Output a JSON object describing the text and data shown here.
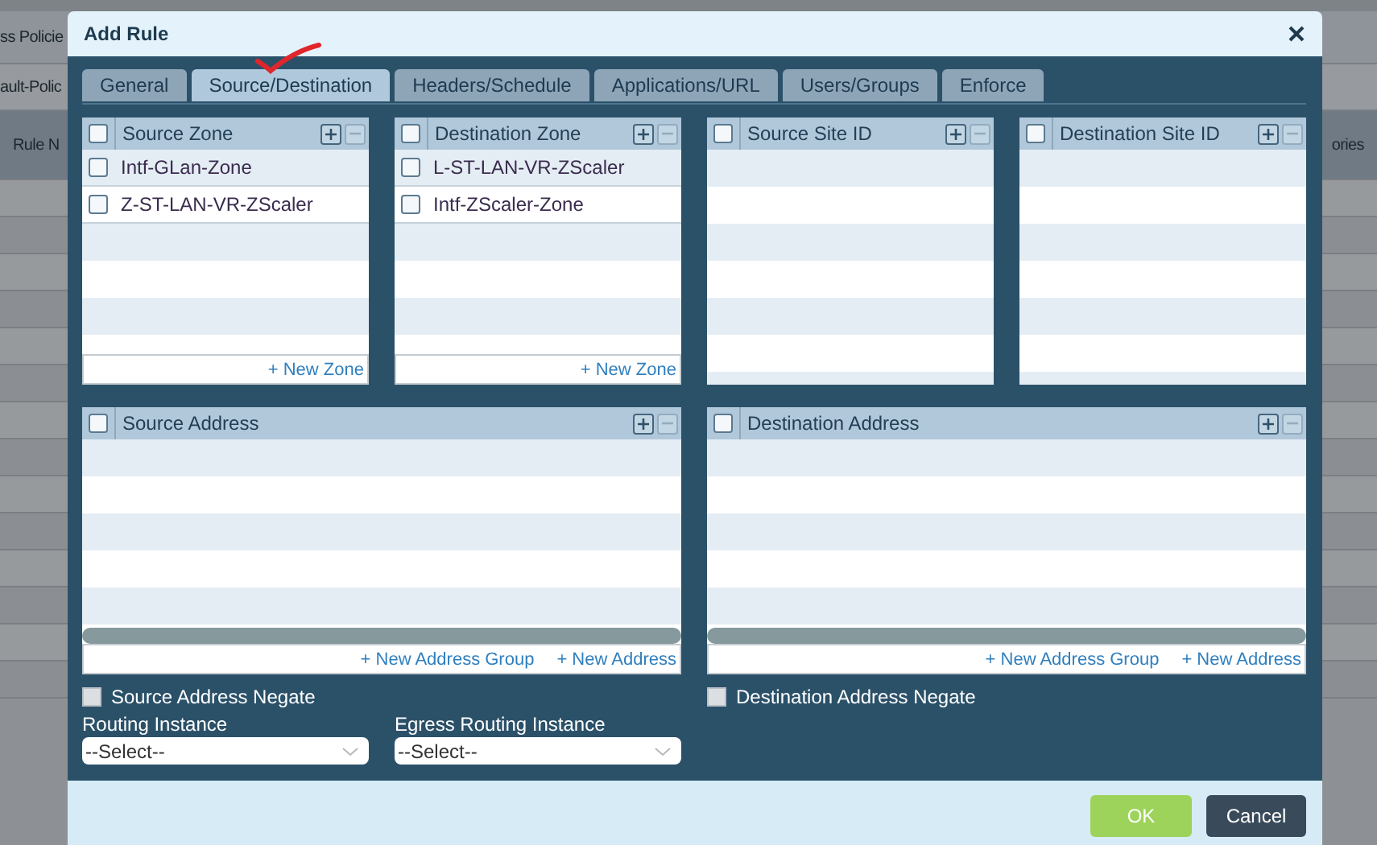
{
  "background": {
    "tab_label": "ss Policie",
    "filter_label": "ault-Polic",
    "column_1": "Rule N",
    "column_last": "ories"
  },
  "dialog": {
    "title": "Add Rule",
    "tabs": [
      {
        "label": "General",
        "selected": false
      },
      {
        "label": "Source/Destination",
        "selected": true
      },
      {
        "label": "Headers/Schedule",
        "selected": false
      },
      {
        "label": "Applications/URL",
        "selected": false
      },
      {
        "label": "Users/Groups",
        "selected": false
      },
      {
        "label": "Enforce",
        "selected": false
      }
    ],
    "zone_panels": [
      {
        "title": "Source Zone",
        "all_checked": false,
        "remove_disabled": true,
        "rows": [
          {
            "label": "Intf-GLan-Zone",
            "checked": false
          },
          {
            "label": "Z-ST-LAN-VR-ZScaler",
            "checked": false
          }
        ],
        "links": [
          "+ New Zone"
        ]
      },
      {
        "title": "Destination Zone",
        "all_checked": false,
        "remove_disabled": true,
        "rows": [
          {
            "label": "L-ST-LAN-VR-ZScaler",
            "checked": false
          },
          {
            "label": "Intf-ZScaler-Zone",
            "checked": false
          }
        ],
        "links": [
          "+ New Zone"
        ]
      },
      {
        "title": "Source Site ID",
        "all_checked": false,
        "remove_disabled": true
      },
      {
        "title": "Destination Site ID",
        "all_checked": false,
        "remove_disabled": true
      }
    ],
    "address_panels": [
      {
        "title": "Source Address",
        "all_checked": false,
        "remove_disabled": true,
        "links": [
          "+ New Address Group",
          "+ New Address"
        ]
      },
      {
        "title": "Destination Address",
        "all_checked": false,
        "remove_disabled": true,
        "links": [
          "+ New Address Group",
          "+ New Address"
        ]
      }
    ],
    "negate_options": [
      {
        "label": "Source Address Negate",
        "checked": false
      },
      {
        "label": "Destination Address Negate",
        "checked": false
      }
    ],
    "selects": [
      {
        "label": "Routing Instance",
        "value": "--Select--"
      },
      {
        "label": "Egress Routing Instance",
        "value": "--Select--"
      }
    ],
    "buttons": [
      {
        "label": "OK",
        "kind": "primary"
      },
      {
        "label": "Cancel",
        "kind": "secondary"
      }
    ]
  }
}
